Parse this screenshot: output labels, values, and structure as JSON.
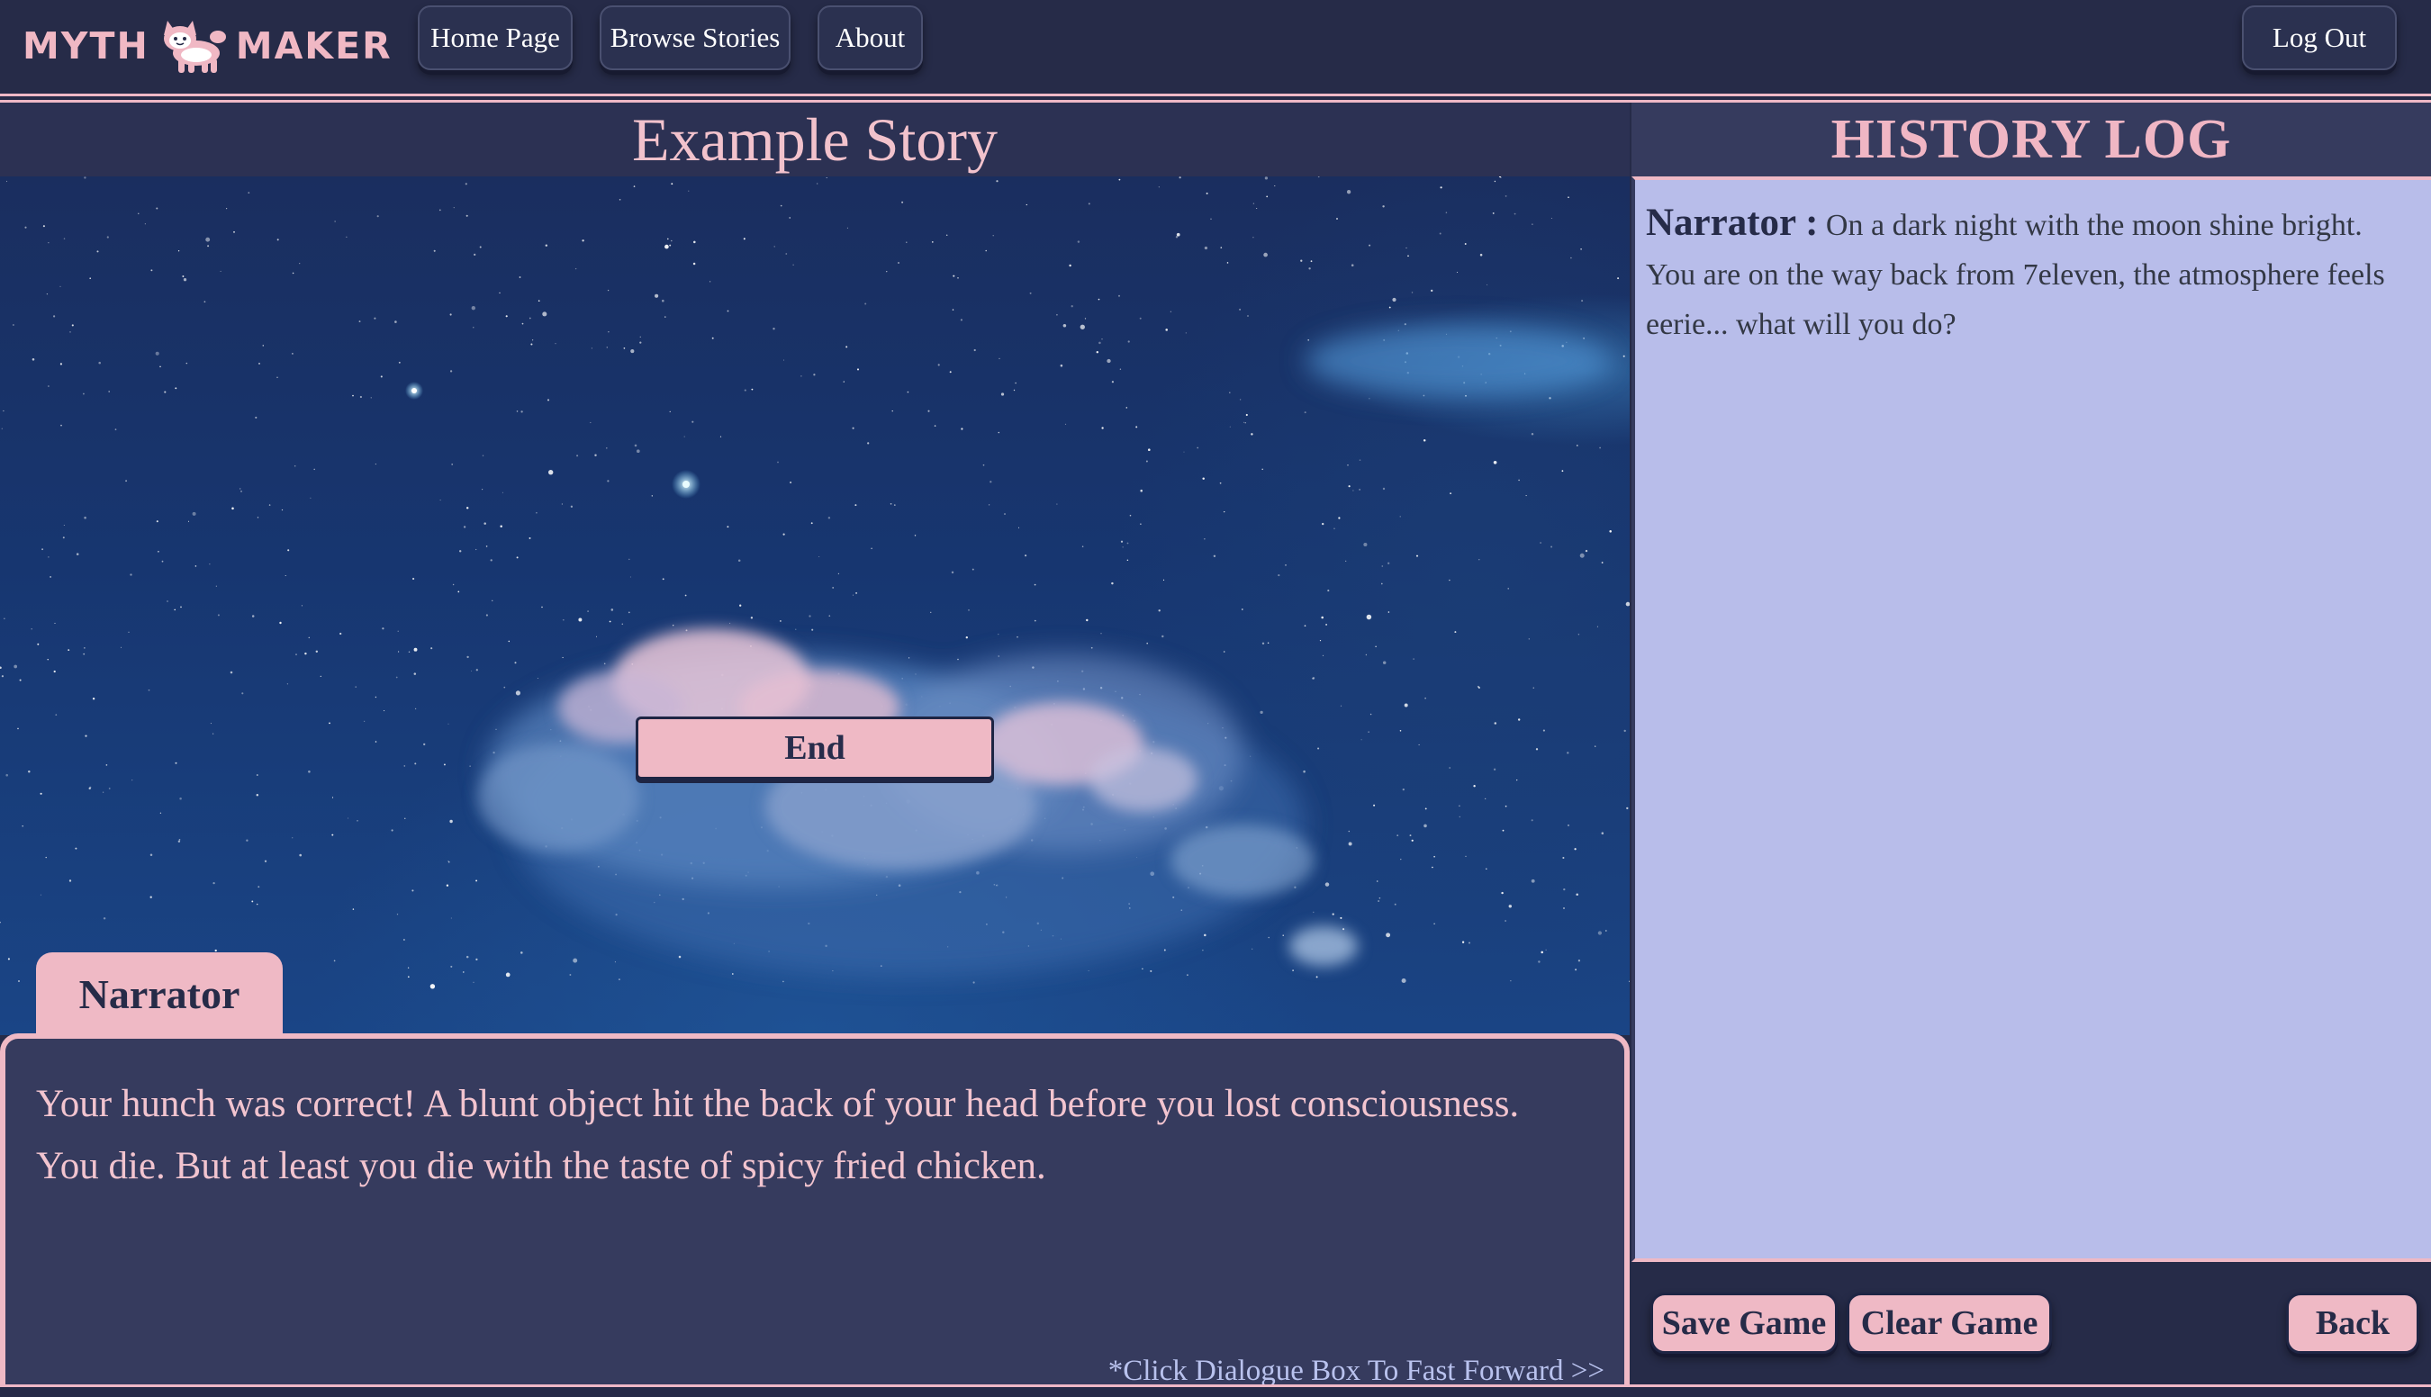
{
  "nav": {
    "logo_left": "MYTH",
    "logo_right": "MAKER",
    "links": [
      "Home Page",
      "Browse Stories",
      "About"
    ],
    "logout_label": "Log Out"
  },
  "story": {
    "title": "Example Story",
    "choice_label": "End",
    "speaker": "Narrator",
    "dialogue": "Your hunch was correct! A blunt object hit the back of your head before you lost consciousness. You die. But at least you die with the taste of spicy fried chicken.",
    "hint": "*Click Dialogue Box To Fast Forward >>"
  },
  "history": {
    "title": "HISTORY LOG",
    "entries": [
      {
        "speaker": "Narrator :",
        "text": "On a dark night with the moon shine bright. You are on the way back from 7eleven, the atmosphere feels eerie... what will you do?"
      }
    ],
    "save_label": "Save Game",
    "clear_label": "Clear Game",
    "back_label": "Back"
  },
  "colors": {
    "background": "#262b48",
    "accent_pink": "#efb9c5",
    "history_panel": "#b8bdea",
    "dialogue_box": "#363b5e",
    "hint_text": "#b9c2ee"
  },
  "icons": {
    "logo": "cat-logo-icon"
  }
}
